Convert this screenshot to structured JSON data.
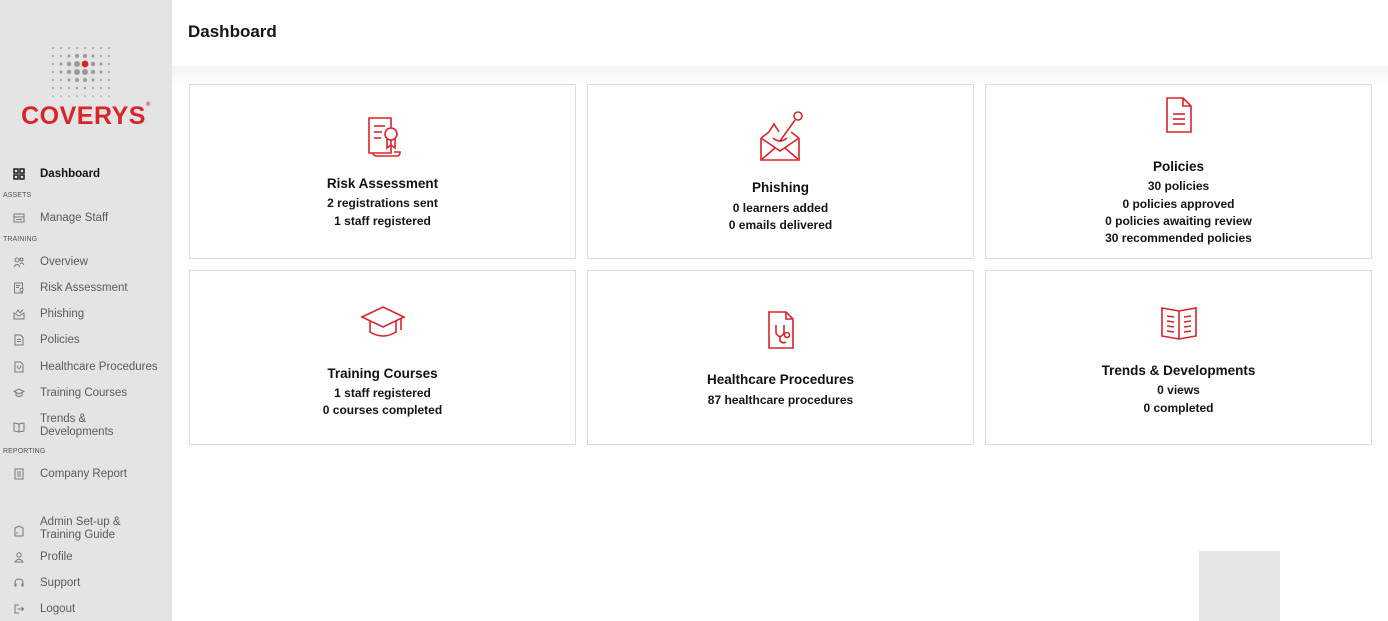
{
  "brand": {
    "name": "COVERYS",
    "color": "#d7252a"
  },
  "page": {
    "title": "Dashboard"
  },
  "sidebar": {
    "dashboard": "Dashboard",
    "sections": {
      "assets": "ASSETS",
      "training": "TRAINING",
      "reporting": "REPORTING"
    },
    "items": {
      "manage_staff": "Manage Staff",
      "overview": "Overview",
      "risk_assessment": "Risk Assessment",
      "phishing": "Phishing",
      "policies": "Policies",
      "healthcare_procedures": "Healthcare Procedures",
      "training_courses": "Training Courses",
      "trends_line1": "Trends &",
      "trends_line2": "Developments",
      "company_report": "Company Report",
      "admin_line1": "Admin Set-up &",
      "admin_line2": "Training Guide",
      "profile": "Profile",
      "support": "Support",
      "logout": "Logout"
    }
  },
  "cards": {
    "risk": {
      "title": "Risk Assessment",
      "lines": [
        "2 registrations sent",
        "1 staff registered"
      ]
    },
    "phishing": {
      "title": "Phishing",
      "lines": [
        "0 learners added",
        "0 emails delivered"
      ]
    },
    "policies": {
      "title": "Policies",
      "lines": [
        "30 policies",
        "0 policies approved",
        "0 policies awaiting review",
        "30 recommended policies"
      ]
    },
    "training": {
      "title": "Training Courses",
      "lines": [
        "1 staff registered",
        "0 courses completed"
      ]
    },
    "healthcare": {
      "title": "Healthcare Procedures",
      "lines": [
        "87 healthcare procedures"
      ]
    },
    "trends": {
      "title": "Trends & Developments",
      "lines": [
        "0 views",
        "0 completed"
      ]
    }
  },
  "icons": {
    "risk": "certificate-icon",
    "phishing": "phishing-envelope-icon",
    "policies": "document-icon",
    "training": "graduation-cap-icon",
    "healthcare": "stethoscope-document-icon",
    "trends": "open-book-icon"
  }
}
